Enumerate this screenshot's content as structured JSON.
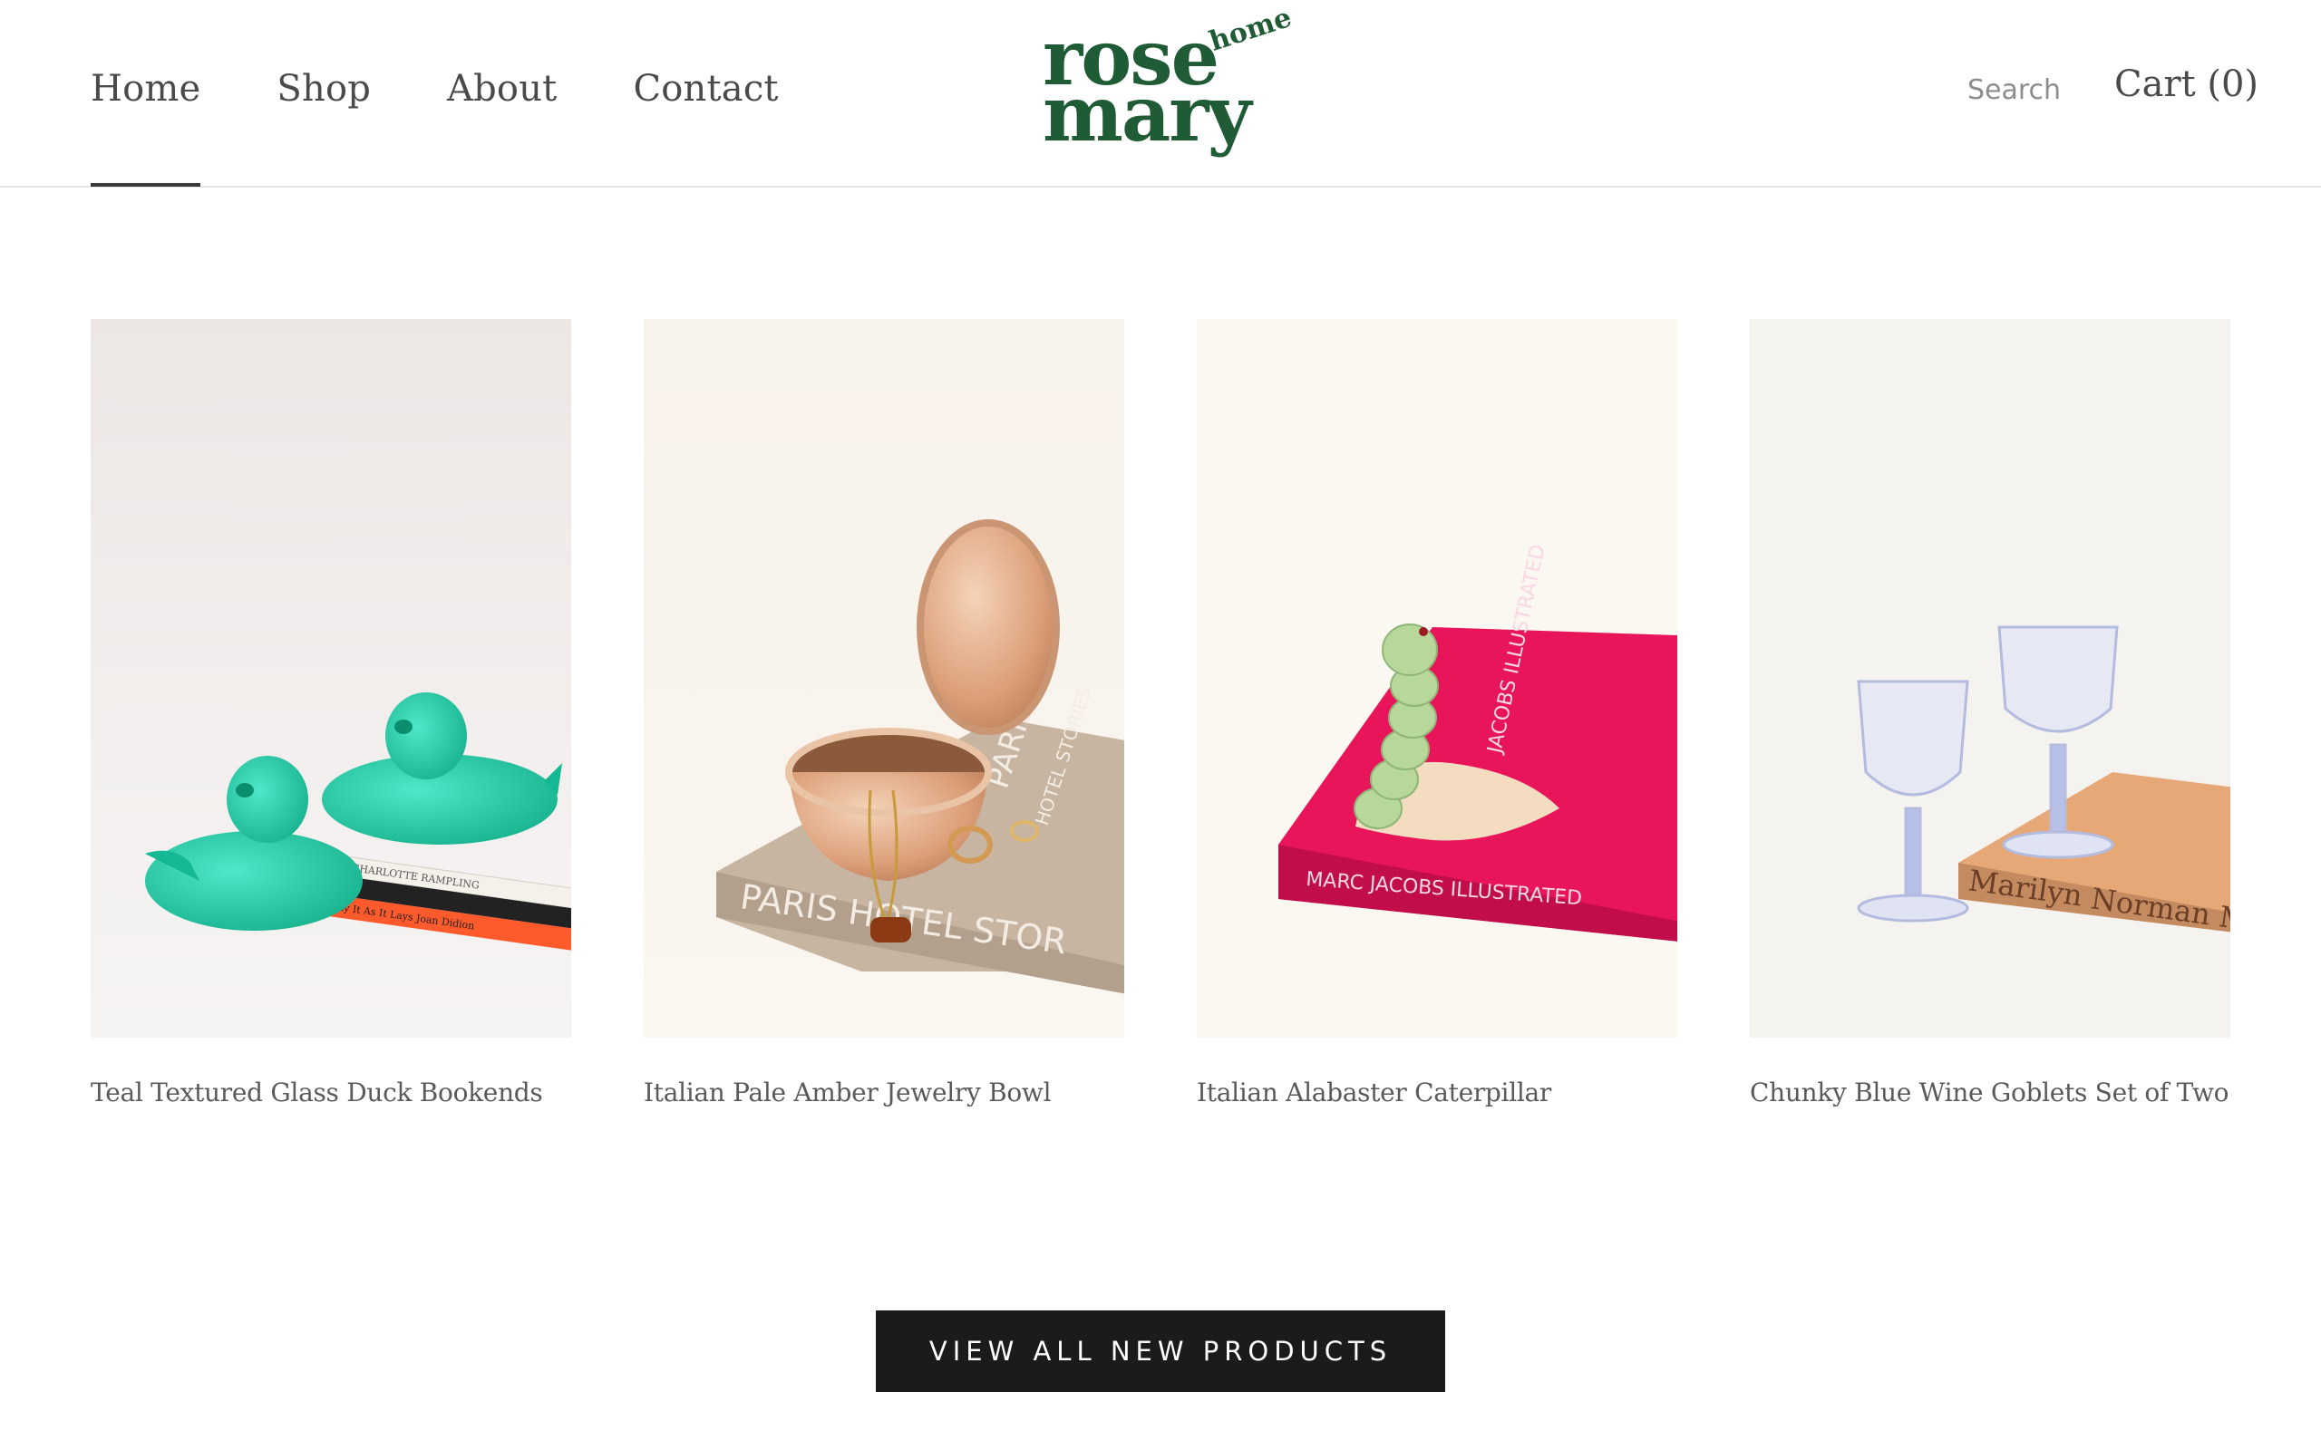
{
  "header": {
    "nav": [
      {
        "label": "Home",
        "active": true
      },
      {
        "label": "Shop",
        "active": false
      },
      {
        "label": "About",
        "active": false
      },
      {
        "label": "Contact",
        "active": false
      }
    ],
    "logo": {
      "line1": "rose",
      "line2": "mary",
      "accent": "home",
      "color": "#1f5c35"
    },
    "search_label": "Search",
    "cart_label": "Cart (0)"
  },
  "products": [
    {
      "title": "Teal Textured Glass Duck Bookends",
      "book_spine_1": "CHARLOTTE RAMPLING",
      "book_spine_2": "Play It As It Lays  Joan Didion"
    },
    {
      "title": "Italian Pale Amber Jewelry Bowl",
      "book_cover_1": "PARIS HOTEL STOR",
      "book_cover_2": "PARIS",
      "book_cover_3": "HOTEL STORIES"
    },
    {
      "title": "Italian Alabaster Caterpillar",
      "book_cover_1": "MARC JACOBS ILLUSTRATED",
      "book_cover_2": "JACOBS ILLUSTRATED"
    },
    {
      "title": "Chunky Blue Wine Goblets Set of Two",
      "book_cover_1": "Marilyn",
      "book_cover_2": "Norman M"
    }
  ],
  "cta_label": "VIEW ALL NEW PRODUCTS",
  "colors": {
    "brand": "#1f5c35",
    "cta_bg": "#1b1b1b",
    "teal": "#1fc3a1",
    "magenta": "#e8155b",
    "amber": "#d9a078"
  }
}
